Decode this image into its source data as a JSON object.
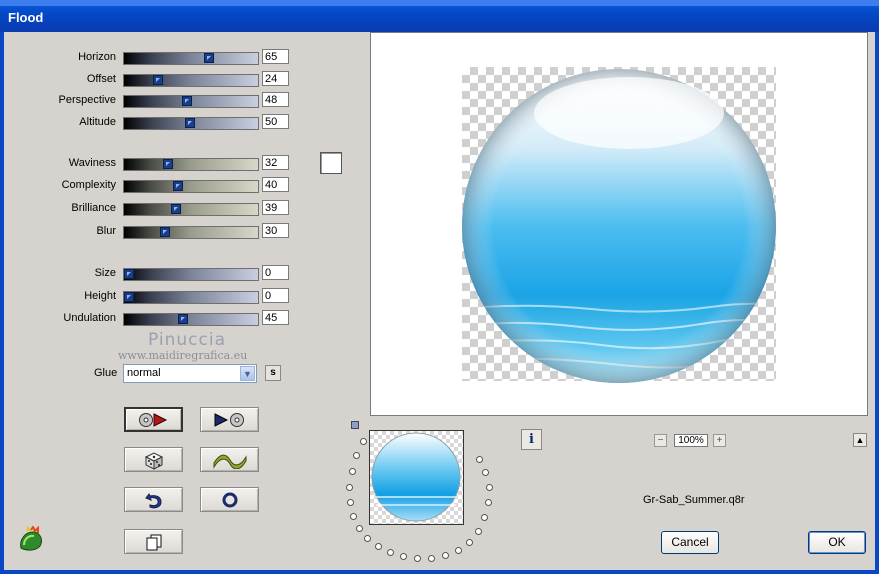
{
  "window": {
    "title": "Flood"
  },
  "sliders_group1": [
    {
      "label": "Horizon",
      "value": "65"
    },
    {
      "label": "Offset",
      "value": "24"
    },
    {
      "label": "Perspective",
      "value": "48"
    },
    {
      "label": "Altitude",
      "value": "50"
    }
  ],
  "sliders_group2": [
    {
      "label": "Waviness",
      "value": "32"
    },
    {
      "label": "Complexity",
      "value": "40"
    },
    {
      "label": "Brilliance",
      "value": "39"
    },
    {
      "label": "Blur",
      "value": "30"
    }
  ],
  "sliders_group3": [
    {
      "label": "Size",
      "value": "0"
    },
    {
      "label": "Height",
      "value": "0"
    },
    {
      "label": "Undulation",
      "value": "45"
    }
  ],
  "watermark": {
    "name": "Pinuccia",
    "site": "www.maidiregrafica.eu"
  },
  "glue": {
    "label": "Glue",
    "value": "normal",
    "s_label": "s"
  },
  "preview": {
    "zoom": "100%",
    "filename": "Gr-Sab_Summer.q8r",
    "info_label": "i"
  },
  "buttons": {
    "cancel": "Cancel",
    "ok": "OK"
  },
  "colors": {
    "title_bar": "#0449c9",
    "swatch": "#ffffff",
    "water": "#1ea6e6"
  }
}
